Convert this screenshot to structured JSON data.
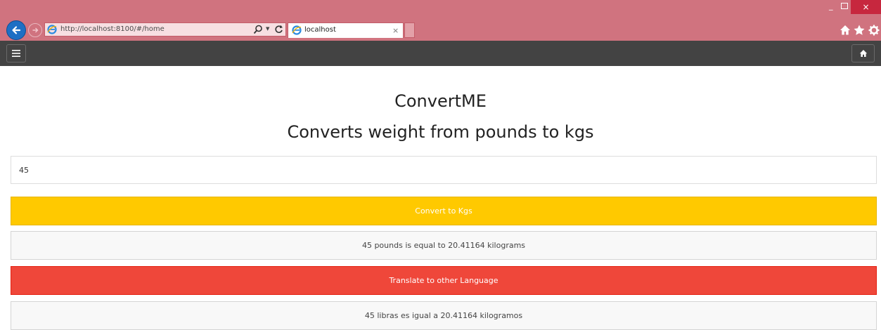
{
  "browser": {
    "address_url": "http://localhost:8100/#/home",
    "tab_title": "localhost",
    "tab_close": "×",
    "window_minimize": "_",
    "window_close": "×"
  },
  "icons": {
    "back": "back-arrow-icon",
    "forward": "forward-arrow-icon",
    "ie": "ie-logo-icon",
    "search": "search-icon",
    "refresh": "refresh-icon",
    "home": "home-icon",
    "favorites": "star-icon",
    "settings": "gear-icon",
    "menu": "hamburger-menu-icon"
  },
  "app": {
    "title": "ConvertME",
    "subtitle": "Converts weight from pounds to kgs",
    "input_value": "45",
    "convert_label": "Convert to Kgs",
    "result_text": "45 pounds is equal to 20.41164 kilograms",
    "translate_label": "Translate to other Language",
    "translated_text": "45 libras es igual a 20.41164 kilogramos"
  },
  "colors": {
    "chrome": "#d0737f",
    "appbar": "#434343",
    "energized": "#ffc900",
    "assertive": "#ef473a"
  }
}
